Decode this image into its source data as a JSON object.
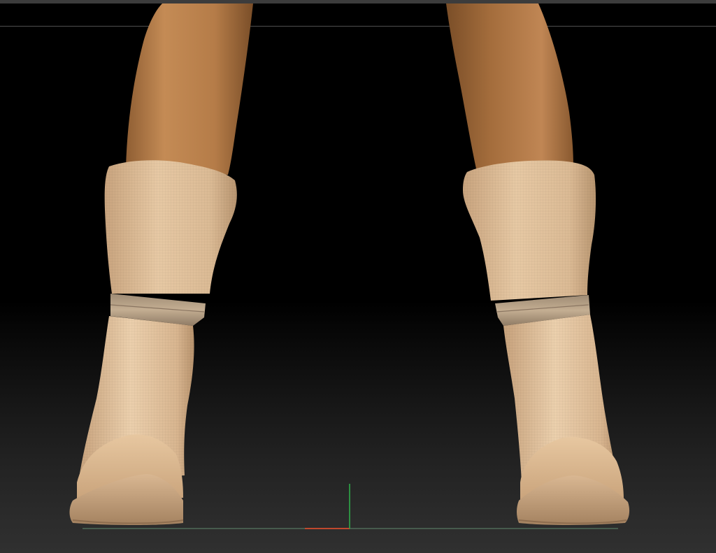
{
  "app": {
    "view": "3d-sculpt-viewport",
    "subject": [
      "left-leg-with-boot",
      "right-leg-with-boot"
    ]
  },
  "colors": {
    "background_top": "#000000",
    "background_bottom": "#303030",
    "skin_light": "#c48b55",
    "skin_dark": "#8a5a30",
    "boot_light": "#ecd0ad",
    "boot_mid": "#d7b48c",
    "boot_shadow": "#a78460",
    "band": "#b7a187",
    "sole": "#cfa982",
    "axis_y": "#2fb24a",
    "axis_x": "#c0482d",
    "floor_line": "#4f6b58"
  },
  "icons": {
    "y_axis": "y-axis-icon",
    "x_axis": "x-axis-icon"
  }
}
